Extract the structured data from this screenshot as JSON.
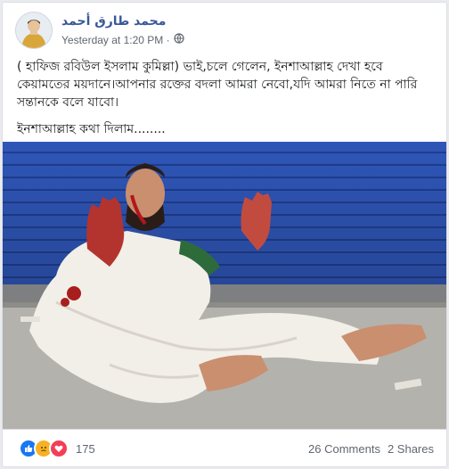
{
  "post": {
    "author": "محمد طارق أحمد",
    "timestamp": "Yesterday at 1:20 PM · ",
    "audience_icon": "globe-icon",
    "text_line1": "( হাফিজ রবিউল ইসলাম কুমিল্লা) ভাই,চলে গেলেন, ইনশাআল্লাহ দেখা হবে কেয়ামতের ময়দানে।আপনার রক্তের বদলা আমরা নেবো,যদি আমরা নিতে না পারি সন্তানকে বলে যাবো।",
    "text_line2": "ইনশাআল্লাহ  কথা দিলাম........"
  },
  "footer": {
    "reactions": [
      "like-icon",
      "sad-icon",
      "love-icon"
    ],
    "reaction_count": "175",
    "comments": "26 Comments",
    "shares": "2 Shares"
  },
  "colors": {
    "link": "#385898",
    "like": "#1877f2",
    "sad": "#f7b125",
    "love": "#f33e58",
    "shutter": "#2f56b8"
  }
}
